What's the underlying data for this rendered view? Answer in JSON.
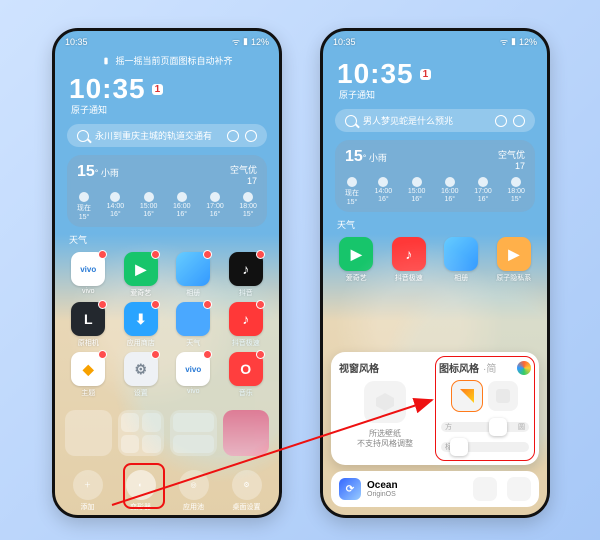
{
  "statusbar": {
    "time": "10:35",
    "battery": "12%"
  },
  "tip": "摇一摇当前页面图标自动补齐",
  "clock": {
    "time": "10:35",
    "day": "1",
    "sub": "原子通知"
  },
  "search": {
    "left_placeholder": "永川到重庆主城的轨道交通有",
    "right_placeholder": "男人梦见蛇是什么预兆"
  },
  "weather": {
    "temp": "15",
    "cond": "小雨",
    "aq_label": "空气优",
    "aq_value": "17",
    "hours": [
      {
        "t": "现在",
        "d": "15°"
      },
      {
        "t": "14:00",
        "d": "16°"
      },
      {
        "t": "15:00",
        "d": "16°"
      },
      {
        "t": "16:00",
        "d": "16°"
      },
      {
        "t": "17:00",
        "d": "16°"
      },
      {
        "t": "18:00",
        "d": "15°"
      }
    ],
    "label": "天气"
  },
  "apps_left": [
    [
      {
        "name": "vivo",
        "bg": "#fff",
        "fg": "#2a7bd6",
        "txt": "vivo"
      },
      {
        "name": "爱奇艺",
        "bg": "#17c56b",
        "txt": "▶"
      },
      {
        "name": "相册",
        "bg": "linear-gradient(135deg,#6cf,#39f)",
        "txt": ""
      },
      {
        "name": "抖音",
        "bg": "#111",
        "txt": "♪"
      }
    ],
    [
      {
        "name": "原相机",
        "bg": "#23282e",
        "txt": "L"
      },
      {
        "name": "应用商店",
        "bg": "#2aa4ff",
        "txt": "⬇"
      },
      {
        "name": "天气",
        "bg": "#4aa8ff",
        "txt": ""
      },
      {
        "name": "抖音极速",
        "bg": "#ff3838",
        "txt": "♪"
      }
    ],
    [
      {
        "name": "主题",
        "bg": "#fff",
        "fg": "#f7a100",
        "txt": "◆"
      },
      {
        "name": "设置",
        "bg": "#eef1f5",
        "fg": "#7c8895",
        "txt": "⚙"
      },
      {
        "name": "vivo",
        "bg": "#fff",
        "fg": "#2a7bd6",
        "txt": "vivo"
      },
      {
        "name": "音乐",
        "bg": "#ff3e3e",
        "txt": "O"
      }
    ]
  ],
  "apps_right": [
    {
      "name": "爱奇艺",
      "bg": "#17c56b",
      "txt": "▶"
    },
    {
      "name": "抖音极速",
      "bg": "#ff3838",
      "txt": "♪"
    },
    {
      "name": "相册",
      "bg": "linear-gradient(135deg,#6cf,#39f)",
      "txt": ""
    },
    {
      "name": "原子隐私系",
      "bg": "#ffb04a",
      "txt": "▶"
    }
  ],
  "dock": [
    {
      "label": "添加",
      "icon": "＋"
    },
    {
      "label": "变形器",
      "icon": "◐",
      "highlight": true
    },
    {
      "label": "应用池",
      "icon": "◎"
    },
    {
      "label": "桌面设置",
      "icon": "⚙"
    }
  ],
  "panel": {
    "left_title": "视窗风格",
    "left_note1": "所选壁纸",
    "left_note2": "不支持风格调整",
    "right_title": "图标风格",
    "right_sub": "·简",
    "slider1_l": "方",
    "slider1_r": "圆",
    "slider2_l": "标准",
    "slider2_r": ""
  },
  "origin": {
    "title": "Ocean",
    "sub": "OriginOS"
  }
}
